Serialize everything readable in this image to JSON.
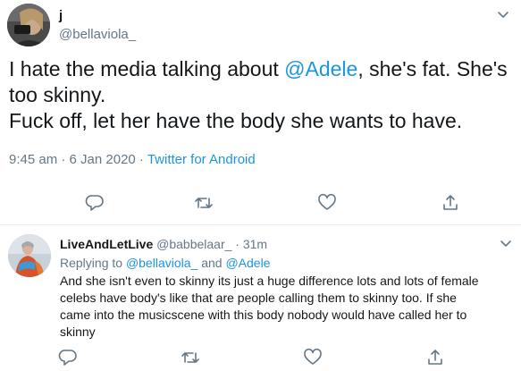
{
  "main_tweet": {
    "author_name": "j",
    "author_handle": "@bellaviola_",
    "text_lines": [
      [
        "I hate the media talking about ",
        "@Adele",
        ", she's fat. She's"
      ],
      [
        "too skinny.",
        "",
        ""
      ],
      [
        "Fuck off, let her have the body she wants to have.",
        "",
        ""
      ]
    ],
    "timestamp": "9:45 am · 6 Jan 2020 · ",
    "client": "Twitter for Android",
    "actions": [
      "reply-icon",
      "retweet-icon",
      "like-icon",
      "share-icon"
    ]
  },
  "reply_tweet": {
    "author_name": "LiveAndLetLive",
    "author_handle": "@babbelaar_ · 31m",
    "replying_prefix": "Replying to ",
    "replying_mention_1": "@bellaviola_",
    "replying_and": " and ",
    "replying_mention_2": "@Adele",
    "text_lines": [
      "And she isn't even to skinny its just a huge difference lots and lots of  female",
      "celebs have body's like that are people calling them to skinny too. If she",
      "came into the musicscene with this body nobody would have called her to",
      "skinny"
    ],
    "actions": [
      "reply-icon",
      "retweet-icon",
      "like-icon",
      "share-icon"
    ]
  },
  "colors": {
    "text": "#14171a",
    "secondary": "#657786",
    "link": "#1b95e0",
    "divider": "#e6ecf0"
  }
}
